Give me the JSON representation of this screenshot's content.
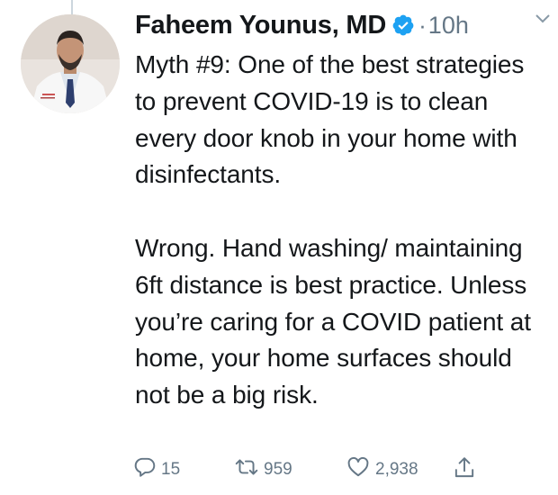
{
  "tweet": {
    "author_name": "Faheem Younus, MD",
    "separator": "·",
    "time": "10h",
    "paragraphs": [
      "Myth #9: One of the best strategies to prevent COVID-19 is to clean every door knob in your home with disinfectants.",
      "Wrong. Hand washing/ maintaining 6ft distance is best practice. Unless you’re caring for a COVID patient at home, your home surfaces should not be a big risk."
    ],
    "actions": {
      "reply_count": "15",
      "retweet_count": "959",
      "like_count": "2,938"
    }
  },
  "icons": {
    "verified": "verified-badge-icon",
    "more": "chevron-down-icon",
    "reply": "reply-icon",
    "retweet": "retweet-icon",
    "like": "heart-icon",
    "share": "share-icon"
  },
  "colors": {
    "verified": "#1da1f2",
    "muted": "#657786",
    "text": "#14171a"
  }
}
